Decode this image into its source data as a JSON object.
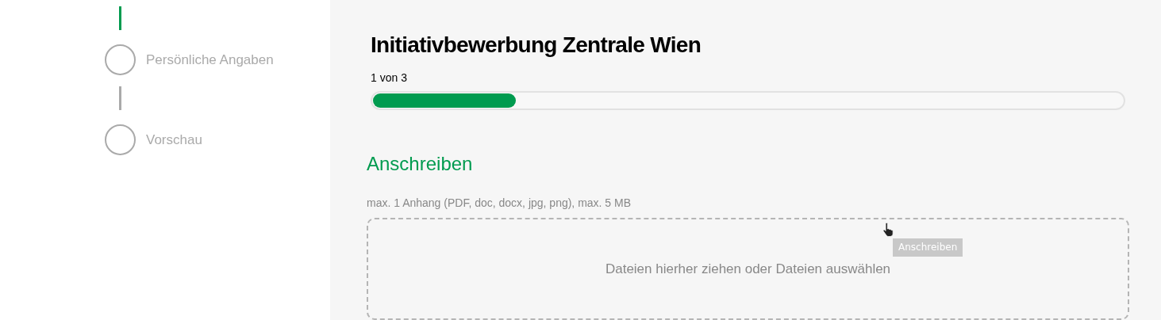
{
  "steps": [
    {
      "label": "Persönliche Angaben",
      "connector_active": true
    },
    {
      "label": "Vorschau",
      "connector_active": false
    }
  ],
  "title": "Initiativbewerbung Zentrale Wien",
  "progress": {
    "label": "1 von 3",
    "level": 0.19
  },
  "section": {
    "heading": "Anschreiben",
    "hint": "max. 1 Anhang (PDF, doc, docx, jpg, png), max. 5 MB",
    "dropzone_text": "Dateien hierher ziehen oder Dateien auswählen",
    "tooltip": "Anschreiben"
  }
}
